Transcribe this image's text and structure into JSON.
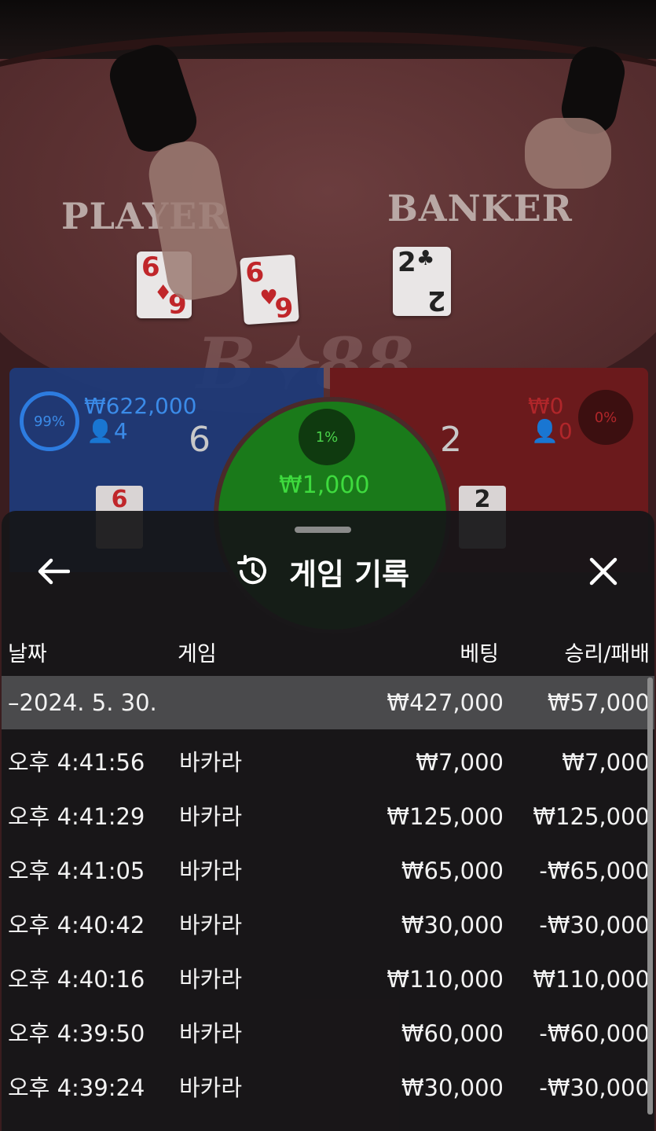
{
  "table": {
    "player_label": "PLAYER",
    "banker_label": "BANKER",
    "player_card1_rank": "6",
    "player_card1_suit": "♦",
    "player_card2_rank": "6",
    "player_card2_suit": "♥",
    "banker_card1_rank": "2",
    "banker_card1_suit": "♣"
  },
  "betting": {
    "player_percent": "99%",
    "player_amount": "₩622,000",
    "player_count": "4",
    "player_score": "6",
    "banker_percent": "0%",
    "banker_amount": "₩0",
    "banker_count": "0",
    "banker_score": "2",
    "tie_percent": "1%",
    "tie_amount": "₩1,000",
    "player_mini_card": "6",
    "banker_mini_card": "2"
  },
  "sheet": {
    "title": "게임 기록",
    "columns": {
      "date": "날짜",
      "game": "게임",
      "bet": "베팅",
      "result": "승리/패배"
    },
    "summary": {
      "date": "–2024. 5. 30.",
      "bet": "₩427,000",
      "result": "₩57,000"
    },
    "rows": [
      {
        "time": "오후 4:41:56",
        "game": "바카라",
        "bet": "₩7,000",
        "result": "₩7,000"
      },
      {
        "time": "오후 4:41:29",
        "game": "바카라",
        "bet": "₩125,000",
        "result": "₩125,000"
      },
      {
        "time": "오후 4:41:05",
        "game": "바카라",
        "bet": "₩65,000",
        "result": "-₩65,000"
      },
      {
        "time": "오후 4:40:42",
        "game": "바카라",
        "bet": "₩30,000",
        "result": "-₩30,000"
      },
      {
        "time": "오후 4:40:16",
        "game": "바카라",
        "bet": "₩110,000",
        "result": "₩110,000"
      },
      {
        "time": "오후 4:39:50",
        "game": "바카라",
        "bet": "₩60,000",
        "result": "-₩60,000"
      },
      {
        "time": "오후 4:39:24",
        "game": "바카라",
        "bet": "₩30,000",
        "result": "-₩30,000"
      }
    ]
  },
  "icons": {
    "back": "back-arrow-icon",
    "history": "history-clock-icon",
    "close": "close-icon",
    "person": "person-icon"
  },
  "colors": {
    "player": "#3b8be8",
    "banker": "#b0262a",
    "tie": "#3edb3e",
    "sheet_bg": "#161618",
    "summary_bg": "#4a4a4c"
  }
}
